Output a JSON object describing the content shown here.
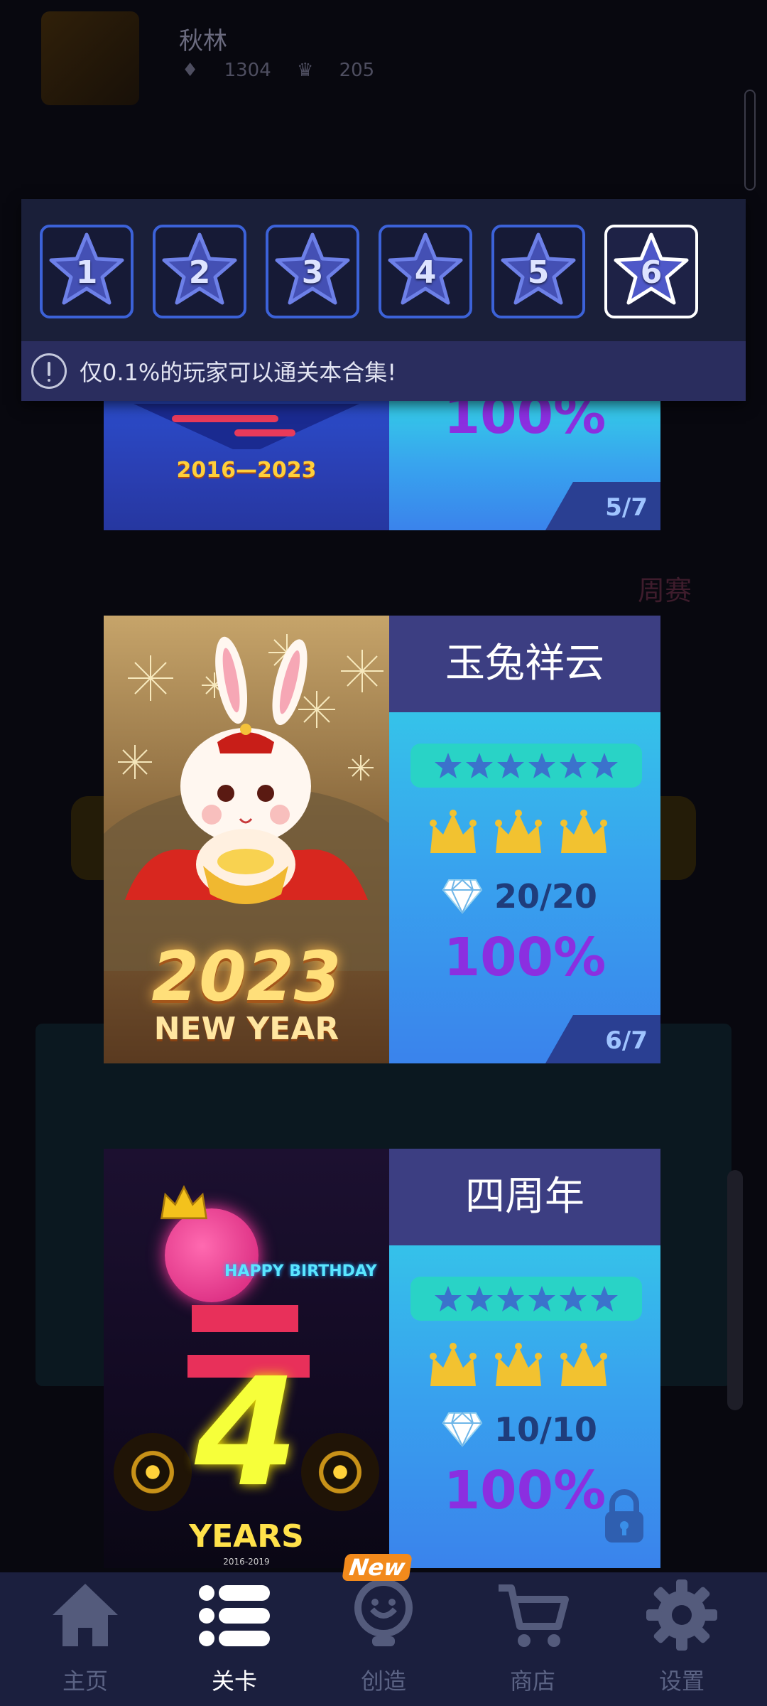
{
  "profile": {
    "name": "秋林",
    "diamonds": "1304",
    "crowns": "205"
  },
  "background": {
    "weekly_label": "周赛"
  },
  "star_tabs": [
    {
      "label": "1",
      "active": false
    },
    {
      "label": "2",
      "active": false
    },
    {
      "label": "3",
      "active": false
    },
    {
      "label": "4",
      "active": false
    },
    {
      "label": "5",
      "active": false
    },
    {
      "label": "6",
      "active": true
    }
  ],
  "notice": {
    "text": "仅0.1%的玩家可以通关本合集!"
  },
  "cards": [
    {
      "art_text": "2016—2023",
      "percent": "100%",
      "page": "5/7"
    },
    {
      "title": "玉兔祥云",
      "art_year": "2023",
      "art_caption": "NEW YEAR",
      "gems": "20/20",
      "percent": "100%",
      "page": "6/7"
    },
    {
      "title": "四周年",
      "art_number": "4",
      "art_caption": "YEARS",
      "art_greeting": "HAPPY BIRTHDAY",
      "art_range": "2016-2019",
      "gems": "10/10",
      "percent": "100%",
      "locked": true
    }
  ],
  "rating": {
    "stars": 6,
    "crowns": 3
  },
  "nav": {
    "home": "主页",
    "levels": "关卡",
    "create": "创造",
    "shop": "商店",
    "settings": "设置",
    "new_badge": "New"
  },
  "colors": {
    "accent_blue": "#3c62d8",
    "percent_purple": "#8b2fe0",
    "title_bar": "#3c3e82",
    "crown_gold": "#f2c230"
  }
}
